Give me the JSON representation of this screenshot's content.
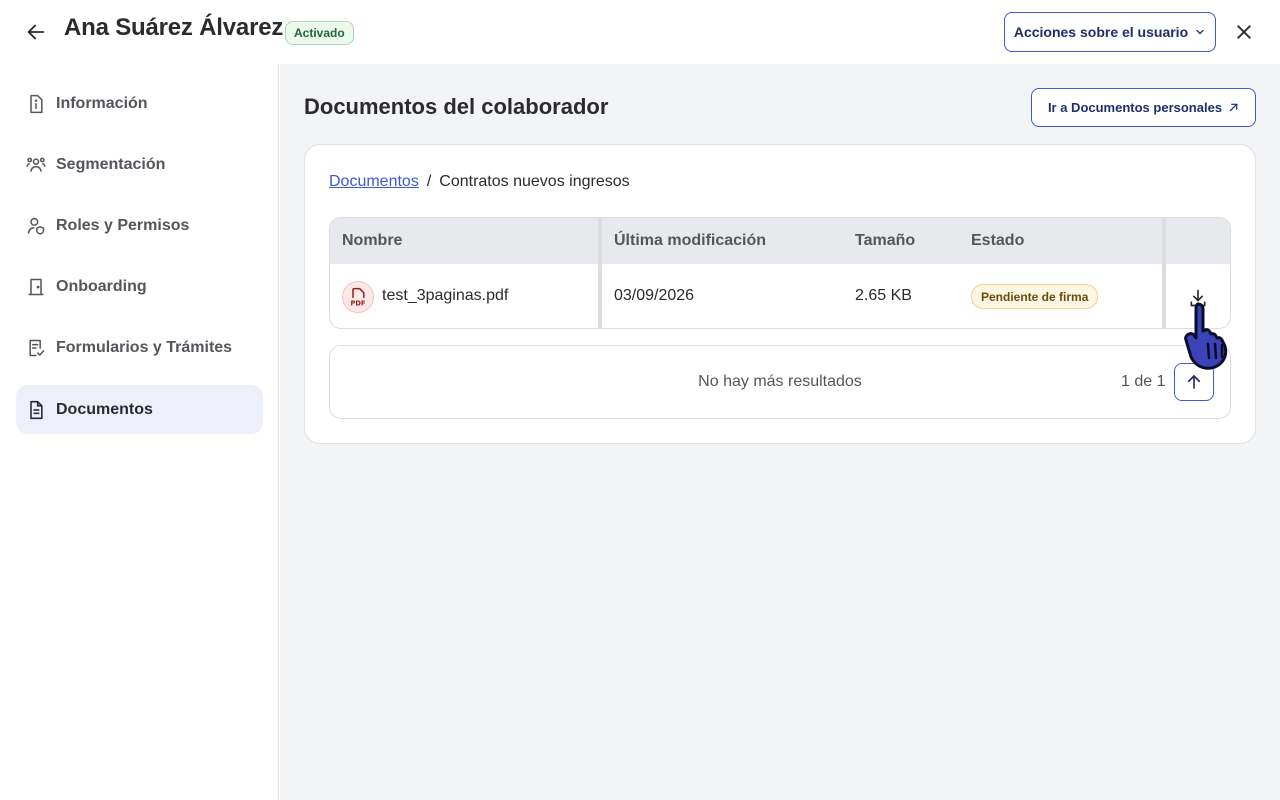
{
  "header": {
    "user_name": "Ana Suárez Álvarez",
    "status": "Activado",
    "actions_label": "Acciones sobre el usuario"
  },
  "sidebar": {
    "items": [
      {
        "label": "Información",
        "icon": "info-doc-icon",
        "active": false
      },
      {
        "label": "Segmentación",
        "icon": "group-icon",
        "active": false
      },
      {
        "label": "Roles y Permisos",
        "icon": "user-shield-icon",
        "active": false
      },
      {
        "label": "Onboarding",
        "icon": "door-icon",
        "active": false
      },
      {
        "label": "Formularios y Trámites",
        "icon": "form-check-icon",
        "active": false
      },
      {
        "label": "Documentos",
        "icon": "document-icon",
        "active": true
      }
    ]
  },
  "main": {
    "title": "Documentos del colaborador",
    "external_button": "Ir a Documentos personales",
    "breadcrumb": {
      "root": "Documentos",
      "separator": "/",
      "current": "Contratos nuevos ingresos"
    },
    "table": {
      "headers": [
        "Nombre",
        "Última modificación",
        "Tamaño",
        "Estado"
      ],
      "rows": [
        {
          "name": "test_3paginas.pdf",
          "modified": "03/09/2026",
          "size": "2.65 KB",
          "status": "Pendiente de firma"
        }
      ]
    },
    "pager": {
      "message": "No hay más resultados",
      "count": "1 de 1"
    }
  },
  "colors": {
    "accent": "#3b5bd0",
    "active_bg": "#edf0fb",
    "page_bg": "#f3f4f6",
    "success": "#1c6b32",
    "warning_bg": "#fdf6e3"
  }
}
